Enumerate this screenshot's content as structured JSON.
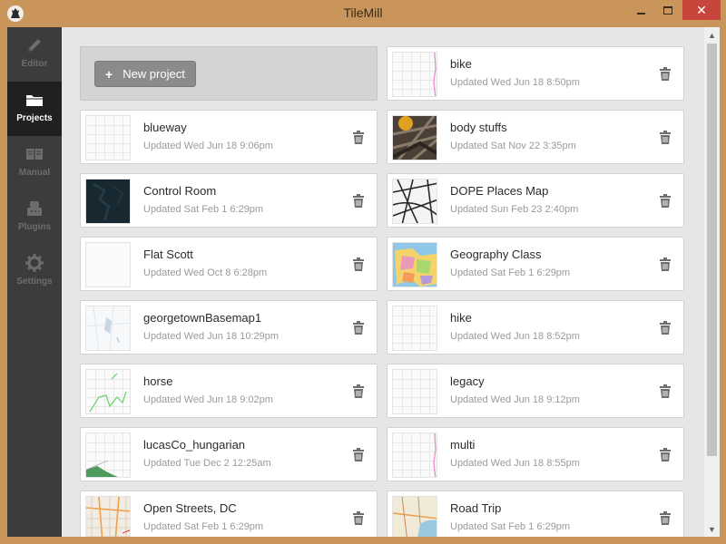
{
  "window": {
    "title": "TileMill",
    "minimize_glyph": "",
    "maximize_glyph": "",
    "close_glyph": "✕"
  },
  "sidebar": {
    "items": [
      {
        "label": "Editor",
        "icon": "pencil-icon",
        "active": false
      },
      {
        "label": "Projects",
        "icon": "folder-icon",
        "active": true
      },
      {
        "label": "Manual",
        "icon": "book-icon",
        "active": false
      },
      {
        "label": "Plugins",
        "icon": "plugin-icon",
        "active": false
      },
      {
        "label": "Settings",
        "icon": "gear-icon",
        "active": false
      }
    ]
  },
  "new_project": {
    "plus": "+",
    "label": "New project"
  },
  "projects": [
    {
      "name": "bike",
      "updated": "Updated Wed Jun 18 8:50pm",
      "thumb": "grid-pink-line"
    },
    {
      "name": "blueway",
      "updated": "Updated Wed Jun 18 9:06pm",
      "thumb": "grid"
    },
    {
      "name": "body stuffs",
      "updated": "Updated Sat Nov 22 3:35pm",
      "thumb": "photo"
    },
    {
      "name": "Control Room",
      "updated": "Updated Sat Feb 1 6:29pm",
      "thumb": "dark"
    },
    {
      "name": "DOPE Places Map",
      "updated": "Updated Sun Feb 23 2:40pm",
      "thumb": "streets-bw"
    },
    {
      "name": "Flat Scott",
      "updated": "Updated Wed Oct 8 6:28pm",
      "thumb": "blank"
    },
    {
      "name": "Geography Class",
      "updated": "Updated Sat Feb 1 6:29pm",
      "thumb": "geography"
    },
    {
      "name": "georgetownBasemap1",
      "updated": "Updated Wed Jun 18 10:29pm",
      "thumb": "light-gray"
    },
    {
      "name": "hike",
      "updated": "Updated Wed Jun 18 8:52pm",
      "thumb": "grid"
    },
    {
      "name": "horse",
      "updated": "Updated Wed Jun 18 9:02pm",
      "thumb": "green-lines"
    },
    {
      "name": "legacy",
      "updated": "Updated Wed Jun 18 9:12pm",
      "thumb": "grid"
    },
    {
      "name": "lucasCo_hungarian",
      "updated": "Updated Tue Dec 2 12:25am",
      "thumb": "green-hill"
    },
    {
      "name": "multi",
      "updated": "Updated Wed Jun 18 8:55pm",
      "thumb": "grid-pink-line"
    },
    {
      "name": "Open Streets, DC",
      "updated": "Updated Sat Feb 1 6:29pm",
      "thumb": "streets-color"
    },
    {
      "name": "Road Trip",
      "updated": "Updated Sat Feb 1 6:29pm",
      "thumb": "road-trip"
    }
  ],
  "scrollbar": {
    "up_glyph": "▲",
    "down_glyph": "▼"
  },
  "colors": {
    "window_frame": "#c9955a",
    "sidebar": "#3c3c3c",
    "sidebar_active": "#202020",
    "content_bg": "#e6e6e6",
    "new_button": "#8b8b8b",
    "close_button": "#c7463c"
  }
}
